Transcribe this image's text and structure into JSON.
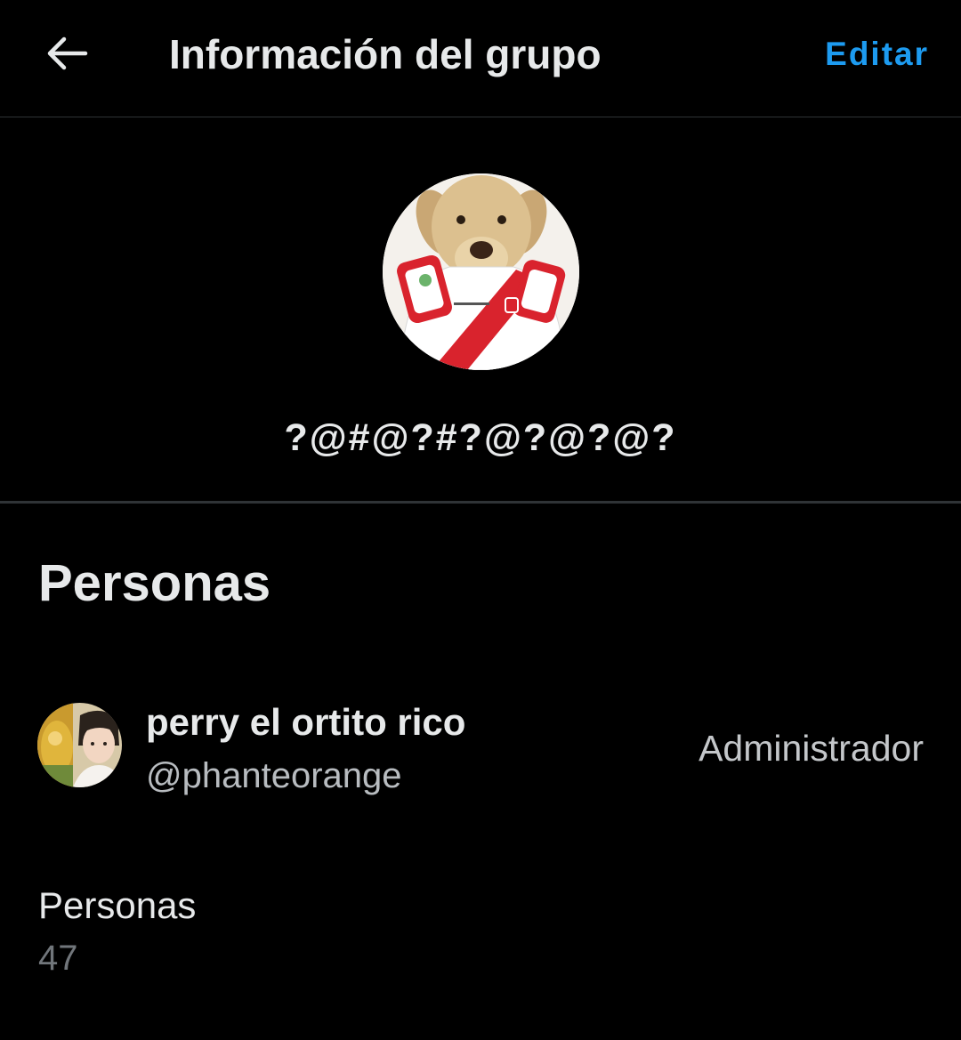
{
  "header": {
    "title": "Información del grupo",
    "edit_label": "Editar",
    "back_icon": "arrow-left-icon"
  },
  "group": {
    "name": "?@#@?#?@?@?@?",
    "avatar_icon": "group-avatar-dog-jersey"
  },
  "people_section": {
    "title": "Personas",
    "members": [
      {
        "name": "perry el ortito rico",
        "handle": "@phanteorange",
        "role": "Administrador",
        "avatar_icon": "user-avatar"
      }
    ],
    "count_label": "Personas",
    "count_value": "47"
  },
  "colors": {
    "background": "#000000",
    "accent": "#1d9bf0",
    "text_primary": "#e7e9ea",
    "text_secondary": "#71767b",
    "divider": "#2f3336"
  }
}
